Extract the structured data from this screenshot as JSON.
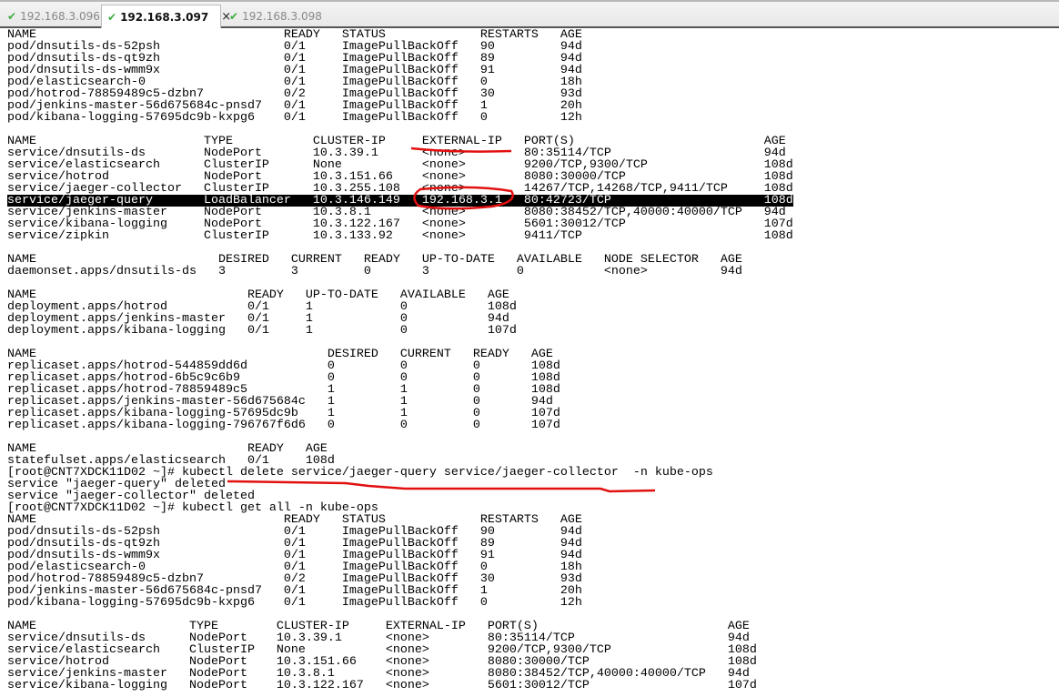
{
  "tabs": [
    {
      "label": "192.168.3.096",
      "active": false
    },
    {
      "label": "192.168.3.097",
      "active": true,
      "close": "×"
    },
    {
      "label": "192.168.3.098",
      "active": false
    }
  ],
  "terminal": {
    "highlight_row": "service/jaeger-query",
    "sections": [
      {
        "type": "table",
        "rows": [
          [
            "NAME",
            "READY",
            "STATUS",
            "RESTARTS",
            "AGE"
          ],
          [
            "pod/dnsutils-ds-52psh",
            "0/1",
            "ImagePullBackOff",
            "90",
            "94d"
          ],
          [
            "pod/dnsutils-ds-qt9zh",
            "0/1",
            "ImagePullBackOff",
            "89",
            "94d"
          ],
          [
            "pod/dnsutils-ds-wmm9x",
            "0/1",
            "ImagePullBackOff",
            "91",
            "94d"
          ],
          [
            "pod/elasticsearch-0",
            "0/1",
            "ImagePullBackOff",
            "0",
            "18h"
          ],
          [
            "pod/hotrod-78859489c5-dzbn7",
            "0/2",
            "ImagePullBackOff",
            "30",
            "93d"
          ],
          [
            "pod/jenkins-master-56d675684c-pnsd7",
            "0/1",
            "ImagePullBackOff",
            "1",
            "20h"
          ],
          [
            "pod/kibana-logging-57695dc9b-kxpg6",
            "0/1",
            "ImagePullBackOff",
            "0",
            "12h"
          ]
        ]
      },
      {
        "type": "text",
        "lines": [
          ""
        ]
      },
      {
        "type": "table",
        "rows": [
          [
            "NAME",
            "TYPE",
            "CLUSTER-IP",
            "EXTERNAL-IP",
            "PORT(S)",
            "AGE"
          ],
          [
            "service/dnsutils-ds",
            "NodePort",
            "10.3.39.1",
            "<none>",
            "80:35114/TCP",
            "94d"
          ],
          [
            "service/elasticsearch",
            "ClusterIP",
            "None",
            "<none>",
            "9200/TCP,9300/TCP",
            "108d"
          ],
          [
            "service/hotrod",
            "NodePort",
            "10.3.151.66",
            "<none>",
            "8080:30000/TCP",
            "108d"
          ],
          [
            "service/jaeger-collector",
            "ClusterIP",
            "10.3.255.108",
            "<none>",
            "14267/TCP,14268/TCP,9411/TCP",
            "108d"
          ],
          [
            "service/jaeger-query",
            "LoadBalancer",
            "10.3.146.149",
            "192.168.3.1",
            "80:42723/TCP",
            "108d"
          ],
          [
            "service/jenkins-master",
            "NodePort",
            "10.3.8.1",
            "<none>",
            "8080:38452/TCP,40000:40000/TCP",
            "94d"
          ],
          [
            "service/kibana-logging",
            "NodePort",
            "10.3.122.167",
            "<none>",
            "5601:30012/TCP",
            "107d"
          ],
          [
            "service/zipkin",
            "ClusterIP",
            "10.3.133.92",
            "<none>",
            "9411/TCP",
            "108d"
          ]
        ]
      },
      {
        "type": "text",
        "lines": [
          ""
        ]
      },
      {
        "type": "table",
        "rows": [
          [
            "NAME",
            "DESIRED",
            "CURRENT",
            "READY",
            "UP-TO-DATE",
            "AVAILABLE",
            "NODE SELECTOR",
            "AGE"
          ],
          [
            "daemonset.apps/dnsutils-ds",
            "3",
            "3",
            "0",
            "3",
            "0",
            "<none>",
            "94d"
          ]
        ]
      },
      {
        "type": "text",
        "lines": [
          ""
        ]
      },
      {
        "type": "table",
        "rows": [
          [
            "NAME",
            "READY",
            "UP-TO-DATE",
            "AVAILABLE",
            "AGE"
          ],
          [
            "deployment.apps/hotrod",
            "0/1",
            "1",
            "0",
            "108d"
          ],
          [
            "deployment.apps/jenkins-master",
            "0/1",
            "1",
            "0",
            "94d"
          ],
          [
            "deployment.apps/kibana-logging",
            "0/1",
            "1",
            "0",
            "107d"
          ]
        ]
      },
      {
        "type": "text",
        "lines": [
          ""
        ]
      },
      {
        "type": "table",
        "rows": [
          [
            "NAME",
            "DESIRED",
            "CURRENT",
            "READY",
            "AGE"
          ],
          [
            "replicaset.apps/hotrod-544859dd6d",
            "0",
            "0",
            "0",
            "108d"
          ],
          [
            "replicaset.apps/hotrod-6b5c9c6b9",
            "0",
            "0",
            "0",
            "108d"
          ],
          [
            "replicaset.apps/hotrod-78859489c5",
            "1",
            "1",
            "0",
            "108d"
          ],
          [
            "replicaset.apps/jenkins-master-56d675684c",
            "1",
            "1",
            "0",
            "94d"
          ],
          [
            "replicaset.apps/kibana-logging-57695dc9b",
            "1",
            "1",
            "0",
            "107d"
          ],
          [
            "replicaset.apps/kibana-logging-796767f6d6",
            "0",
            "0",
            "0",
            "107d"
          ]
        ]
      },
      {
        "type": "text",
        "lines": [
          ""
        ]
      },
      {
        "type": "table",
        "rows": [
          [
            "NAME",
            "READY",
            "AGE"
          ],
          [
            "statefulset.apps/elasticsearch",
            "0/1",
            "108d"
          ]
        ]
      },
      {
        "type": "text",
        "lines": [
          "[root@CNT7XDCK11D02 ~]# kubectl delete service/jaeger-query service/jaeger-collector  -n kube-ops",
          "service \"jaeger-query\" deleted",
          "service \"jaeger-collector\" deleted",
          "[root@CNT7XDCK11D02 ~]# kubectl get all -n kube-ops"
        ]
      },
      {
        "type": "table",
        "rows": [
          [
            "NAME",
            "READY",
            "STATUS",
            "RESTARTS",
            "AGE"
          ],
          [
            "pod/dnsutils-ds-52psh",
            "0/1",
            "ImagePullBackOff",
            "90",
            "94d"
          ],
          [
            "pod/dnsutils-ds-qt9zh",
            "0/1",
            "ImagePullBackOff",
            "89",
            "94d"
          ],
          [
            "pod/dnsutils-ds-wmm9x",
            "0/1",
            "ImagePullBackOff",
            "91",
            "94d"
          ],
          [
            "pod/elasticsearch-0",
            "0/1",
            "ImagePullBackOff",
            "0",
            "18h"
          ],
          [
            "pod/hotrod-78859489c5-dzbn7",
            "0/2",
            "ImagePullBackOff",
            "30",
            "93d"
          ],
          [
            "pod/jenkins-master-56d675684c-pnsd7",
            "0/1",
            "ImagePullBackOff",
            "1",
            "20h"
          ],
          [
            "pod/kibana-logging-57695dc9b-kxpg6",
            "0/1",
            "ImagePullBackOff",
            "0",
            "12h"
          ]
        ]
      },
      {
        "type": "text",
        "lines": [
          ""
        ]
      },
      {
        "type": "table",
        "rows": [
          [
            "NAME",
            "TYPE",
            "CLUSTER-IP",
            "EXTERNAL-IP",
            "PORT(S)",
            "AGE"
          ],
          [
            "service/dnsutils-ds",
            "NodePort",
            "10.3.39.1",
            "<none>",
            "80:35114/TCP",
            "94d"
          ],
          [
            "service/elasticsearch",
            "ClusterIP",
            "None",
            "<none>",
            "9200/TCP,9300/TCP",
            "108d"
          ],
          [
            "service/hotrod",
            "NodePort",
            "10.3.151.66",
            "<none>",
            "8080:30000/TCP",
            "108d"
          ],
          [
            "service/jenkins-master",
            "NodePort",
            "10.3.8.1",
            "<none>",
            "8080:38452/TCP,40000:40000/TCP",
            "94d"
          ],
          [
            "service/kibana-logging",
            "NodePort",
            "10.3.122.167",
            "<none>",
            "5601:30012/TCP",
            "107d"
          ]
        ]
      }
    ]
  },
  "colors": {
    "annotation": "#e31010",
    "check": "#3fae3f"
  }
}
